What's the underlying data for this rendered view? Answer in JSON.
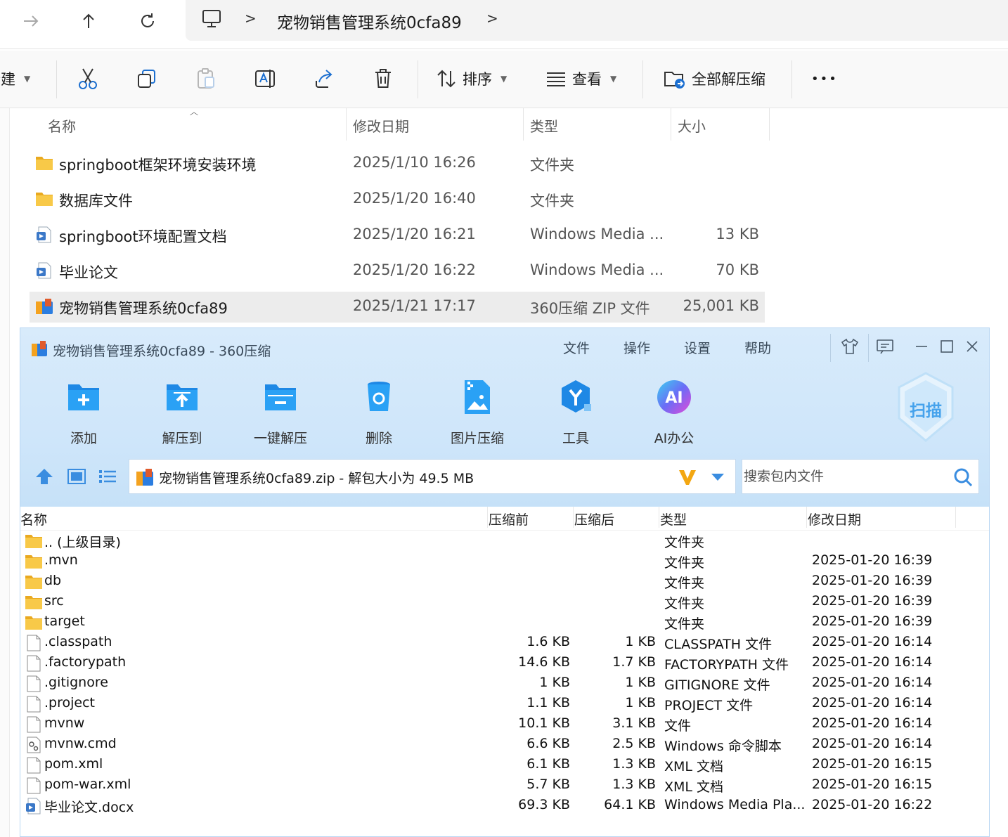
{
  "address": {
    "breadcrumb": "宠物销售管理系统0cfa89",
    "separator": ">"
  },
  "toolbar": {
    "new_label": "新建",
    "sort_label": "排序",
    "view_label": "查看",
    "extract_all_label": "全部解压缩",
    "more_label": "•••"
  },
  "explorer": {
    "columns": {
      "name": "名称",
      "date": "修改日期",
      "type": "类型",
      "size": "大小"
    },
    "rows": [
      {
        "name": "springboot框架环境安装环境",
        "date": "2025/1/10 16:26",
        "type": "文件夹",
        "size": "",
        "icon": "folder-icon"
      },
      {
        "name": "数据库文件",
        "date": "2025/1/20 16:40",
        "type": "文件夹",
        "size": "",
        "icon": "folder-icon"
      },
      {
        "name": "springboot环境配置文档",
        "date": "2025/1/20 16:21",
        "type": "Windows Media ...",
        "size": "13 KB",
        "icon": "media-doc-icon"
      },
      {
        "name": "毕业论文",
        "date": "2025/1/20 16:22",
        "type": "Windows Media ...",
        "size": "70 KB",
        "icon": "media-doc-icon"
      },
      {
        "name": "宠物销售管理系统0cfa89",
        "date": "2025/1/21 17:17",
        "type": "360压缩 ZIP 文件",
        "size": "25,001 KB",
        "icon": "zip-archive-icon"
      }
    ]
  },
  "zip": {
    "title": "宠物销售管理系统0cfa89 - 360压缩",
    "menu": [
      "文件",
      "操作",
      "设置",
      "帮助"
    ],
    "tools": [
      "添加",
      "解压到",
      "一键解压",
      "删除",
      "图片压缩",
      "工具",
      "AI办公"
    ],
    "scan_label": "扫描",
    "ai_badge": "AI",
    "path_text": "宠物销售管理系统0cfa89.zip - 解包大小为 49.5 MB",
    "search_placeholder": "搜索包内文件",
    "columns": {
      "name": "名称",
      "before": "压缩前",
      "after": "压缩后",
      "type": "类型",
      "date": "修改日期"
    },
    "rows": [
      {
        "name": ".. (上级目录)",
        "before": "",
        "after": "",
        "type": "文件夹",
        "date": "",
        "icon": "folder-icon"
      },
      {
        "name": ".mvn",
        "before": "",
        "after": "",
        "type": "文件夹",
        "date": "2025-01-20 16:39",
        "icon": "folder-icon"
      },
      {
        "name": "db",
        "before": "",
        "after": "",
        "type": "文件夹",
        "date": "2025-01-20 16:39",
        "icon": "folder-icon"
      },
      {
        "name": "src",
        "before": "",
        "after": "",
        "type": "文件夹",
        "date": "2025-01-20 16:39",
        "icon": "folder-icon"
      },
      {
        "name": "target",
        "before": "",
        "after": "",
        "type": "文件夹",
        "date": "2025-01-20 16:39",
        "icon": "folder-icon"
      },
      {
        "name": ".classpath",
        "before": "1.6 KB",
        "after": "1 KB",
        "type": "CLASSPATH 文件",
        "date": "2025-01-20 16:14",
        "icon": "file-icon"
      },
      {
        "name": ".factorypath",
        "before": "14.6 KB",
        "after": "1.7 KB",
        "type": "FACTORYPATH 文件",
        "date": "2025-01-20 16:14",
        "icon": "file-icon"
      },
      {
        "name": ".gitignore",
        "before": "1 KB",
        "after": "1 KB",
        "type": "GITIGNORE 文件",
        "date": "2025-01-20 16:14",
        "icon": "file-icon"
      },
      {
        "name": ".project",
        "before": "1.1 KB",
        "after": "1 KB",
        "type": "PROJECT 文件",
        "date": "2025-01-20 16:14",
        "icon": "file-icon"
      },
      {
        "name": "mvnw",
        "before": "10.1 KB",
        "after": "3.1 KB",
        "type": "文件",
        "date": "2025-01-20 16:14",
        "icon": "file-icon"
      },
      {
        "name": "mvnw.cmd",
        "before": "6.6 KB",
        "after": "2.5 KB",
        "type": "Windows 命令脚本",
        "date": "2025-01-20 16:14",
        "icon": "script-file-icon"
      },
      {
        "name": "pom.xml",
        "before": "6.1 KB",
        "after": "1.3 KB",
        "type": "XML 文档",
        "date": "2025-01-20 16:15",
        "icon": "file-icon"
      },
      {
        "name": "pom-war.xml",
        "before": "5.7 KB",
        "after": "1.3 KB",
        "type": "XML 文档",
        "date": "2025-01-20 16:15",
        "icon": "file-icon"
      },
      {
        "name": "毕业论文.docx",
        "before": "69.3 KB",
        "after": "64.1 KB",
        "type": "Windows Media Pla...",
        "date": "2025-01-20 16:22",
        "icon": "media-doc-icon"
      }
    ]
  },
  "colors": {
    "accent": "#1c8ef0",
    "folder": "#f6c344",
    "zip_bg": "#d3e8fa"
  }
}
